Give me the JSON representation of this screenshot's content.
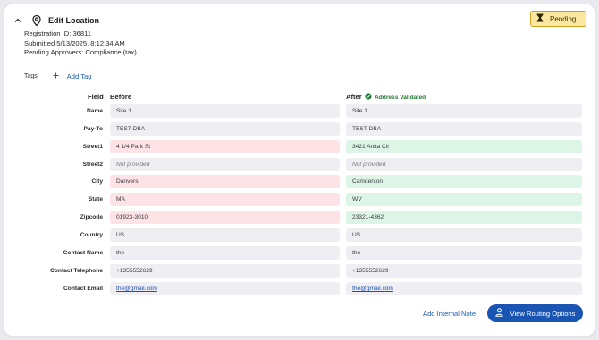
{
  "header": {
    "title": "Edit Location",
    "status": "Pending"
  },
  "meta": {
    "registration": "Registration ID: 36811",
    "submitted": "Submitted 5/13/2025, 8:12:34 AM",
    "approvers": "Pending Approvers: Compliance (tax)"
  },
  "tags": {
    "label": "Tags:",
    "add_label": "Add Tag"
  },
  "columns": {
    "field": "Field",
    "before": "Before",
    "after": "After",
    "validated": "Address Validated"
  },
  "rows": [
    {
      "label": "Name",
      "before": "Site 1",
      "after": "Site 1"
    },
    {
      "label": "Pay-To",
      "before": "TEST DBA",
      "after": "TEST DBA"
    },
    {
      "label": "Street1",
      "before": "4 1/4 Park St",
      "after": "3421 Anita Cir"
    },
    {
      "label": "Street2",
      "before": "Not provided",
      "after": "Not provided"
    },
    {
      "label": "City",
      "before": "Danvers",
      "after": "Camdenton"
    },
    {
      "label": "State",
      "before": "MA",
      "after": "WV"
    },
    {
      "label": "Zipcode",
      "before": "01923-3010",
      "after": "23321-4362"
    },
    {
      "label": "Country",
      "before": "US",
      "after": "US"
    },
    {
      "label": "Contact Name",
      "before": "the",
      "after": "the"
    },
    {
      "label": "Contact Telephone",
      "before": "+1355552629",
      "after": "+1355552629"
    },
    {
      "label": "Contact Email",
      "before": "the@gmail.com",
      "after": "the@gmail.com"
    }
  ],
  "actions": {
    "internal_note": "Add Internal Note",
    "routing": "View Routing Options"
  },
  "colors": {
    "accent": "#1a55b3",
    "pending_bg": "#fbe7a0",
    "removed": "#fde2e6",
    "added": "#dcf5e6",
    "validated": "#1f7a32"
  },
  "icons": [
    "chevron-up-icon",
    "location-pin-icon",
    "hourglass-icon",
    "plus-icon",
    "check-circle-icon",
    "person-icon"
  ]
}
